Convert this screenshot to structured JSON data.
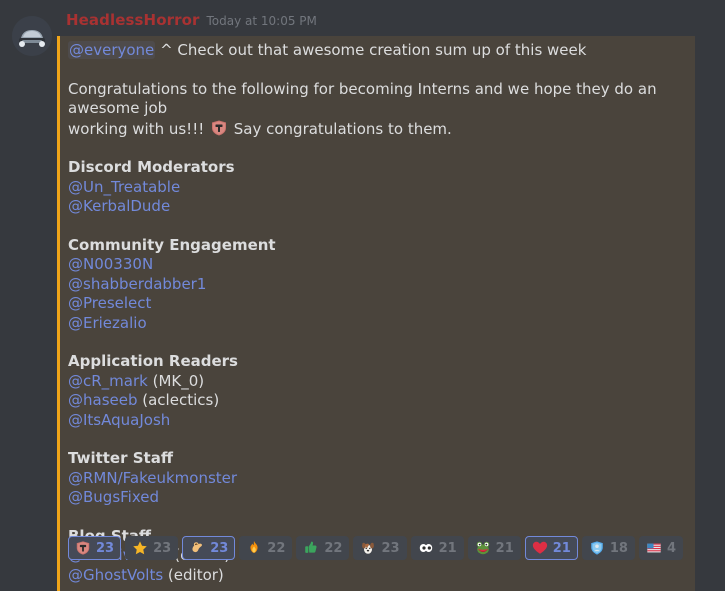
{
  "message": {
    "author": "HeadlessHorror",
    "author_color": "#a83232",
    "timestamp": "Today at 10:05 PM",
    "avatar_name": "car-avatar",
    "mention_highlight_bg": "#4a443c",
    "mention_bar_color": "#f0a519",
    "mention_link_color": "#7289da",
    "lines": [
      {
        "type": "text",
        "parts": [
          {
            "kind": "mention",
            "text": "@everyone"
          },
          {
            "kind": "plain",
            "text": " ^ Check out that awesome creation sum up of this week"
          }
        ]
      },
      {
        "type": "spacer"
      },
      {
        "type": "text",
        "parts": [
          {
            "kind": "plain",
            "text": "Congratulations to the following for becoming Interns and we hope they do an awesome job"
          }
        ]
      },
      {
        "type": "text",
        "parts": [
          {
            "kind": "plain",
            "text": "working with us!!! "
          },
          {
            "kind": "emoji",
            "text": "shield-mailbox-emoji"
          },
          {
            "kind": "plain",
            "text": " Say congratulations to them."
          }
        ]
      },
      {
        "type": "spacer"
      },
      {
        "type": "text",
        "parts": [
          {
            "kind": "title",
            "text": "Discord Moderators"
          }
        ]
      },
      {
        "type": "text",
        "parts": [
          {
            "kind": "link",
            "text": "@Un_Treatable"
          }
        ]
      },
      {
        "type": "text",
        "parts": [
          {
            "kind": "link",
            "text": "@KerbalDude"
          }
        ]
      },
      {
        "type": "spacer"
      },
      {
        "type": "text",
        "parts": [
          {
            "kind": "title",
            "text": "Community Engagement"
          }
        ]
      },
      {
        "type": "text",
        "parts": [
          {
            "kind": "link",
            "text": "@N00330N"
          }
        ]
      },
      {
        "type": "text",
        "parts": [
          {
            "kind": "link",
            "text": "@shabberdabber1"
          }
        ]
      },
      {
        "type": "text",
        "parts": [
          {
            "kind": "link",
            "text": "@Preselect"
          }
        ]
      },
      {
        "type": "text",
        "parts": [
          {
            "kind": "link",
            "text": "@Eriezalio"
          }
        ]
      },
      {
        "type": "spacer"
      },
      {
        "type": "text",
        "parts": [
          {
            "kind": "title",
            "text": "Application Readers"
          }
        ]
      },
      {
        "type": "text",
        "parts": [
          {
            "kind": "link",
            "text": "@cR_mark"
          },
          {
            "kind": "plain",
            "text": " (MK_0)"
          }
        ]
      },
      {
        "type": "text",
        "parts": [
          {
            "kind": "link",
            "text": "@haseeb"
          },
          {
            "kind": "plain",
            "text": " (aclectics)"
          }
        ]
      },
      {
        "type": "text",
        "parts": [
          {
            "kind": "link",
            "text": "@ItsAquaJosh"
          }
        ]
      },
      {
        "type": "spacer"
      },
      {
        "type": "text",
        "parts": [
          {
            "kind": "title",
            "text": "Twitter Staff"
          }
        ]
      },
      {
        "type": "text",
        "parts": [
          {
            "kind": "link",
            "text": "@RMN/Fakeukmonster"
          }
        ]
      },
      {
        "type": "text",
        "parts": [
          {
            "kind": "link",
            "text": "@BugsFixed"
          }
        ]
      },
      {
        "type": "spacer"
      },
      {
        "type": "text",
        "parts": [
          {
            "kind": "title",
            "text": "Blog Staff"
          }
        ]
      },
      {
        "type": "text",
        "parts": [
          {
            "kind": "link",
            "text": "@Positive512"
          },
          {
            "kind": "plain",
            "text": " (editor)"
          }
        ]
      },
      {
        "type": "text",
        "parts": [
          {
            "kind": "link",
            "text": "@GhostVolts"
          },
          {
            "kind": "plain",
            "text": " (editor)"
          }
        ]
      }
    ]
  },
  "reactions": [
    {
      "emoji": "shield-mailbox-emoji",
      "count": "23",
      "reacted": true
    },
    {
      "emoji": "star-emoji",
      "count": "23",
      "reacted": false
    },
    {
      "emoji": "ok-hand-emoji",
      "count": "23",
      "reacted": true
    },
    {
      "emoji": "fire-emoji",
      "count": "22",
      "reacted": false
    },
    {
      "emoji": "thumbs-up-emoji",
      "count": "22",
      "reacted": false
    },
    {
      "emoji": "dog-face-emoji",
      "count": "23",
      "reacted": false
    },
    {
      "emoji": "eyes-emoji",
      "count": "21",
      "reacted": false
    },
    {
      "emoji": "frog-emoji",
      "count": "21",
      "reacted": false
    },
    {
      "emoji": "red-heart-emoji",
      "count": "21",
      "reacted": true
    },
    {
      "emoji": "police-badge-emoji",
      "count": "18",
      "reacted": false
    },
    {
      "emoji": "us-flag-emoji",
      "count": "4",
      "reacted": false
    }
  ]
}
